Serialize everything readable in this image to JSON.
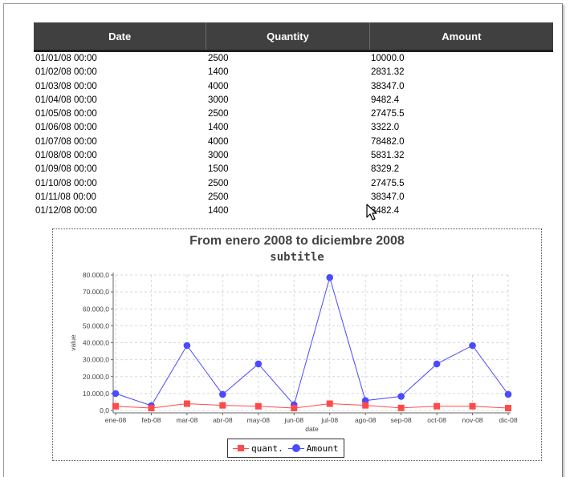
{
  "table": {
    "headers": [
      "Date",
      "Quantity",
      "Amount"
    ],
    "rows": [
      [
        "01/01/08 00:00",
        "2500",
        "10000.0"
      ],
      [
        "01/02/08 00:00",
        "1400",
        "2831.32"
      ],
      [
        "01/03/08 00:00",
        "4000",
        "38347.0"
      ],
      [
        "01/04/08 00:00",
        "3000",
        "9482.4"
      ],
      [
        "01/05/08 00:00",
        "2500",
        "27475.5"
      ],
      [
        "01/06/08 00:00",
        "1400",
        "3322.0"
      ],
      [
        "01/07/08 00:00",
        "4000",
        "78482.0"
      ],
      [
        "01/08/08 00:00",
        "3000",
        "5831.32"
      ],
      [
        "01/09/08 00:00",
        "1500",
        "8329.2"
      ],
      [
        "01/10/08 00:00",
        "2500",
        "27475.5"
      ],
      [
        "01/11/08 00:00",
        "2500",
        "38347.0"
      ],
      [
        "01/12/08 00:00",
        "1400",
        "3482.4"
      ]
    ]
  },
  "colors": {
    "header_bg": "#404040",
    "quant": "#ff4a4a",
    "amount": "#4a4aff"
  },
  "icons": [
    "mouse-pointer-icon"
  ],
  "chart_data": {
    "type": "line",
    "title": "From enero 2008 to diciembre 2008",
    "subtitle": "subtitle",
    "xlabel": "date",
    "ylabel": "value",
    "categories": [
      "ene-08",
      "feb-08",
      "mar-08",
      "abr-08",
      "may-08",
      "jun-08",
      "jul-08",
      "ago-08",
      "sep-08",
      "oct-08",
      "nov-08",
      "dic-08"
    ],
    "ylim": [
      0,
      80000
    ],
    "yticks": [
      0,
      10000,
      20000,
      30000,
      40000,
      50000,
      60000,
      70000,
      80000
    ],
    "ytick_labels": [
      "0,0",
      "10.000,0",
      "20.000,0",
      "30.000,0",
      "40.000,0",
      "50.000,0",
      "60.000,0",
      "70.000,0",
      "80.000,0"
    ],
    "grid": true,
    "legend_position": "bottom",
    "series": [
      {
        "name": "quant.",
        "marker": "square",
        "color": "#ff4a4a",
        "values": [
          2500,
          1400,
          4000,
          3000,
          2500,
          1400,
          4000,
          3000,
          1500,
          2500,
          2500,
          1400
        ]
      },
      {
        "name": "Amount",
        "marker": "circle",
        "color": "#4a4aff",
        "values": [
          10000.0,
          2831.32,
          38347.0,
          9482.4,
          27475.5,
          3322.0,
          78482.0,
          5831.32,
          8329.2,
          27475.5,
          38347.0,
          9482.4
        ]
      }
    ]
  }
}
